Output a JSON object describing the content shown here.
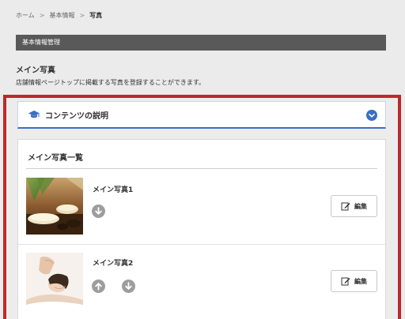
{
  "breadcrumb": {
    "items": [
      "ホーム",
      "基本情報"
    ],
    "separator": ">",
    "current": "写真"
  },
  "section_bar": {
    "label": "基本情報管理"
  },
  "page": {
    "title": "メイン写真",
    "description": "店舗情報ページトップに掲載する写真を登録することができます。"
  },
  "accordion": {
    "label": "コンテンツの説明",
    "icon": "graduation-cap-icon"
  },
  "photo_list": {
    "title": "メイン写真一覧",
    "items": [
      {
        "name": "メイン写真1",
        "edit_label": "編集",
        "image": "spa-stones-towels"
      },
      {
        "name": "メイン写真2",
        "edit_label": "編集",
        "image": "woman-massage"
      }
    ]
  },
  "colors": {
    "highlight_border": "#c0262d",
    "section_bar": "#595959",
    "accent_blue": "#3a6fc4",
    "move_button": "#9d9d9d"
  }
}
